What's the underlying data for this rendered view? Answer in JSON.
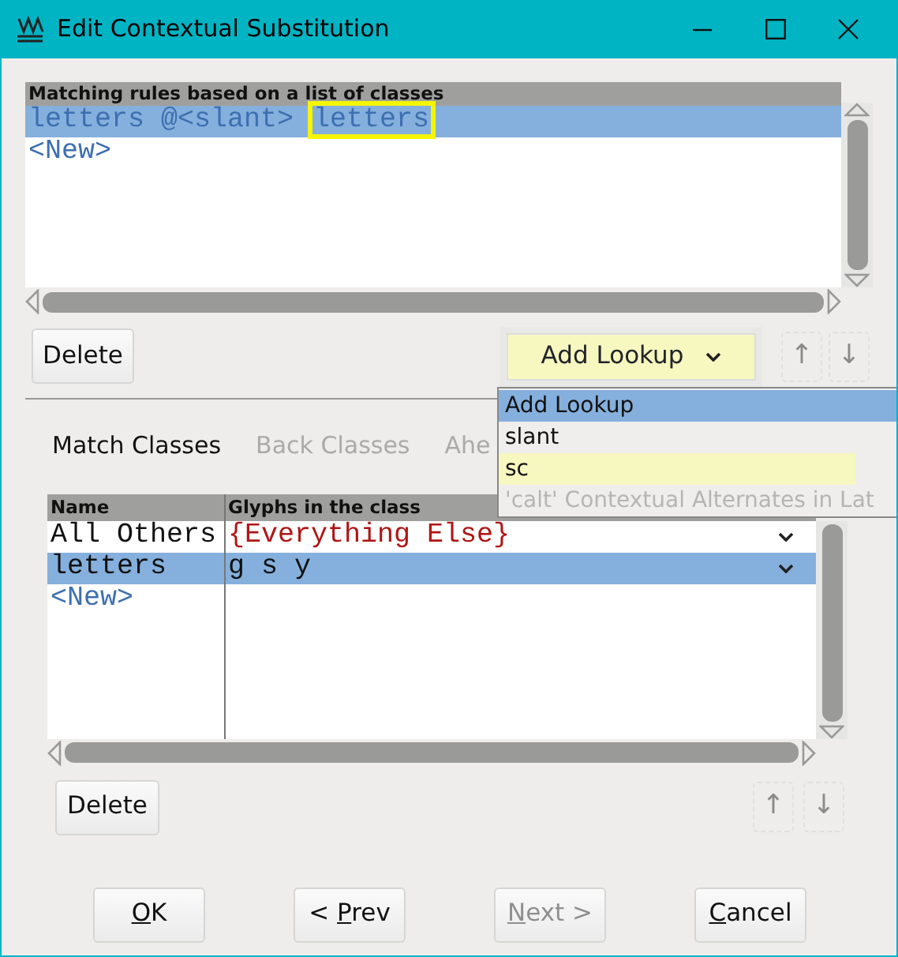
{
  "window": {
    "title": "Edit Contextual Substitution"
  },
  "rules": {
    "header": "Matching rules based on a list of classes",
    "rows": [
      {
        "selected": true,
        "segments": [
          {
            "text": "letters @<slant> ",
            "boxed": false
          },
          {
            "text": "letters",
            "boxed": true
          }
        ]
      },
      {
        "selected": false,
        "segments": [
          {
            "text": "<New>",
            "boxed": false
          }
        ]
      }
    ]
  },
  "rule_buttons": {
    "delete": {
      "label": "Delete",
      "disabled": false
    },
    "lookup_combo": {
      "value": "Add Lookup"
    },
    "up": {
      "label": "↑",
      "disabled": true
    },
    "down": {
      "label": "↓",
      "disabled": true
    }
  },
  "tabs": [
    {
      "label": "Match Classes",
      "selected": true
    },
    {
      "label": "Back Classes",
      "selected": false
    },
    {
      "label": "Ahe",
      "selected": false
    }
  ],
  "classes": {
    "columns": [
      "Name",
      "Glyphs in the class"
    ],
    "rows": [
      {
        "kind": "default",
        "name": "All Others",
        "glyphs": "{Everything Else}",
        "selected": false
      },
      {
        "kind": "class",
        "name": "letters",
        "glyphs": "g s y",
        "selected": true
      },
      {
        "kind": "new",
        "name": "<New>",
        "selected": false
      }
    ]
  },
  "class_buttons": {
    "delete": {
      "label": "Delete",
      "disabled": false
    },
    "up": {
      "label": "↑",
      "disabled": true
    },
    "down": {
      "label": "↓",
      "disabled": true
    }
  },
  "lookup_menu": [
    {
      "label": "Add Lookup",
      "selected": true,
      "highlighted": false,
      "disabled": false
    },
    {
      "label": "slant",
      "selected": false,
      "highlighted": false,
      "disabled": false
    },
    {
      "label": "sc",
      "selected": false,
      "highlighted": true,
      "disabled": false
    },
    {
      "label": "'calt' Contextual Alternates in Lat",
      "selected": false,
      "highlighted": false,
      "disabled": true
    }
  ],
  "footer": [
    {
      "key": "O",
      "after": "K",
      "disabled": false
    },
    {
      "before": "< ",
      "key": "P",
      "after": "rev",
      "disabled": false
    },
    {
      "key": "N",
      "after": "ext >",
      "disabled": true
    },
    {
      "key": "C",
      "after": "ancel",
      "disabled": false
    }
  ]
}
